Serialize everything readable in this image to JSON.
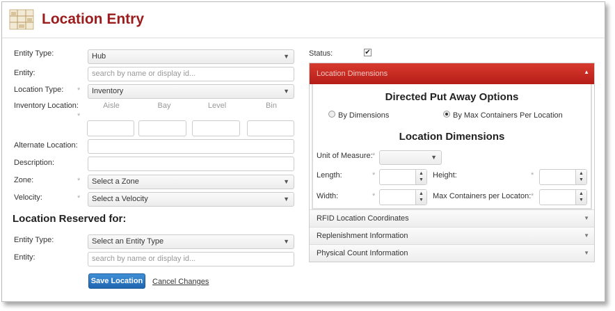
{
  "header": {
    "title": "Location Entry",
    "logo_icon": "warehouse-shelves-icon"
  },
  "form": {
    "entity_type": {
      "label": "Entity Type:",
      "value": "Hub"
    },
    "entity": {
      "label": "Entity:",
      "placeholder": "search by name or display id..."
    },
    "location_type": {
      "label": "Location Type:",
      "value": "Inventory"
    },
    "inventory_location": {
      "label": "Inventory Location:",
      "columns": [
        "Aisle",
        "Bay",
        "Level",
        "Bin"
      ]
    },
    "alternate_location": {
      "label": "Alternate Location:"
    },
    "description": {
      "label": "Description:"
    },
    "zone": {
      "label": "Zone:",
      "value": "Select a Zone"
    },
    "velocity": {
      "label": "Velocity:",
      "value": "Select a Velocity"
    },
    "required_mark": "*"
  },
  "reserved": {
    "title": "Location Reserved for:",
    "entity_type": {
      "label": "Entity Type:",
      "value": "Select an Entity Type"
    },
    "entity": {
      "label": "Entity:",
      "placeholder": "search by name or display id..."
    }
  },
  "actions": {
    "save_label": "Save Location",
    "cancel_label": "Cancel Changes"
  },
  "status": {
    "label": "Status:",
    "checked": true,
    "check_glyph": "✔"
  },
  "panels": {
    "location_dimensions": "Location Dimensions",
    "directed_title": "Directed Put Away Options",
    "radio_by_dimensions": "By Dimensions",
    "radio_by_max": "By Max Containers Per Location",
    "selected_radio": "By Max Containers Per Location",
    "dims_title": "Location Dimensions",
    "unit_of_measure": "Unit of Measure:",
    "length": "Length:",
    "height": "Height:",
    "width": "Width:",
    "max_containers": "Max Containers per Locaton:",
    "rfid": "RFID Location Coordinates",
    "replenishment": "Replenishment Information",
    "physical_count": "Physical Count Information"
  },
  "colors": {
    "accent": "#9b1c1c",
    "panel_active": "#c8281f",
    "button": "#2a75c2"
  }
}
